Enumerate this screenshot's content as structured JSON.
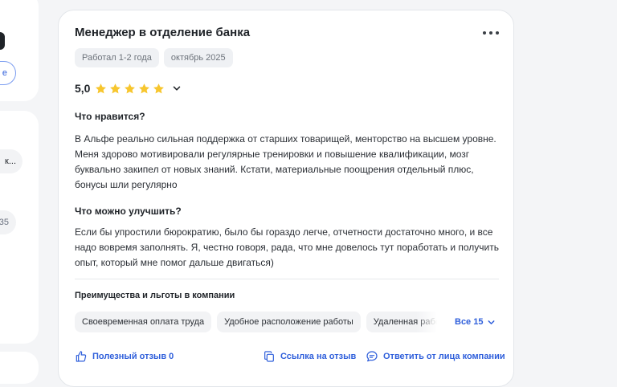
{
  "left_column": {
    "outline_pill_text": "е",
    "pill_text": "к...",
    "number_pill_text": "35"
  },
  "review": {
    "title": "Менеджер в отделение банка",
    "tags": [
      "Работал 1-2 года",
      "октябрь 2025"
    ],
    "rating": {
      "value": "5,0",
      "stars": 5,
      "star_color": "#f7c62e"
    },
    "likes_heading": "Что нравится?",
    "likes_text": "В Альфе реально сильная поддержка от старших товарищей, менторство на высшем уровне. Меня здорово мотивировали регулярные тренировки и повышение квалификации, мозг буквально закипел от новых знаний. Кстати, материальные поощрения отдельный плюс, бонусы шли регулярно",
    "improve_heading": "Что можно улучшить?",
    "improve_text": "Если бы упростили бюрократию, было бы гораздо легче, отчетности достаточно много, и все надо вовремя заполнять. Я, честно говоря, рада, что мне довелось тут поработать и получить опыт, который мне помог дальше двигаться)",
    "benefits_heading": "Преимущества и льготы в компании",
    "benefits": [
      "Своевременная оплата труда",
      "Удобное расположение работы",
      "Удаленная работа"
    ],
    "see_all_label": "Все 15"
  },
  "actions": {
    "helpful_label": "Полезный отзыв 0",
    "link_label": "Ссылка на отзыв",
    "reply_label": "Ответить от лица компании"
  },
  "colors": {
    "accent": "#2f5fdb",
    "star": "#f7c62e"
  }
}
